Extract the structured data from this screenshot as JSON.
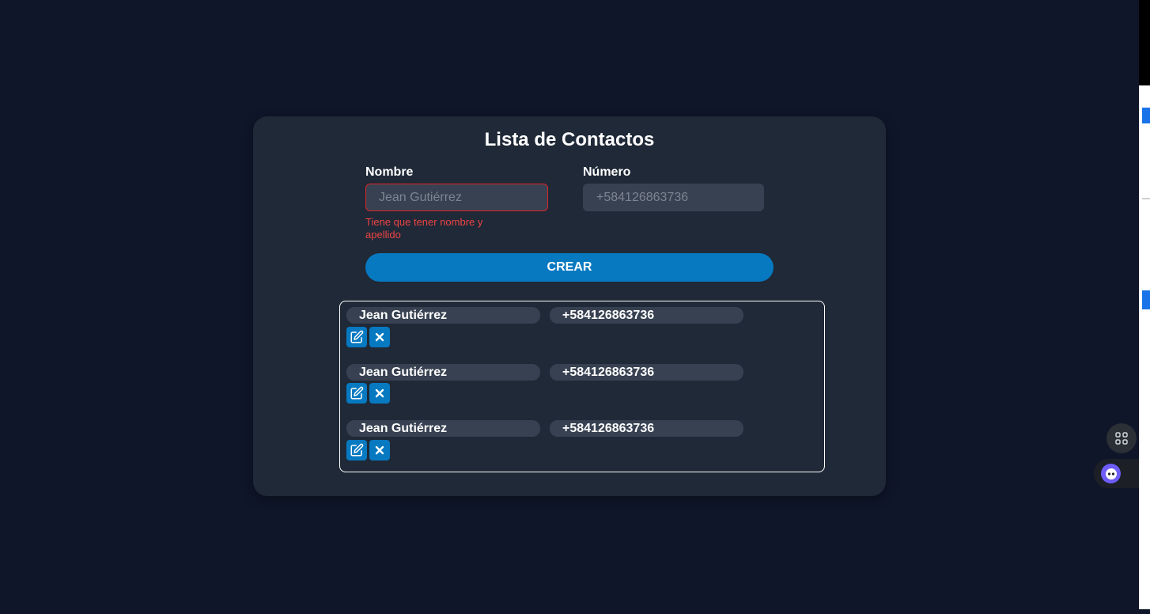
{
  "app": {
    "title": "Lista de Contactos"
  },
  "form": {
    "name_label": "Nombre",
    "name_placeholder": "Jean Gutiérrez",
    "name_error": "Tiene que tener nombre y apellido",
    "number_label": "Número",
    "number_placeholder": "+584126863736",
    "create_label": "CREAR"
  },
  "contacts": [
    {
      "name": "Jean Gutiérrez",
      "phone": "+584126863736"
    },
    {
      "name": "Jean Gutiérrez",
      "phone": "+584126863736"
    },
    {
      "name": "Jean Gutiérrez",
      "phone": "+584126863736"
    }
  ],
  "icons": {
    "edit": "pencil-square-icon",
    "delete": "close-icon",
    "apps": "grid-icon",
    "assistant": "assistant-icon"
  },
  "colors": {
    "background": "#0f1629",
    "card": "#1f2937",
    "field": "#374151",
    "accent": "#0779c1",
    "error": "#dc2626"
  }
}
